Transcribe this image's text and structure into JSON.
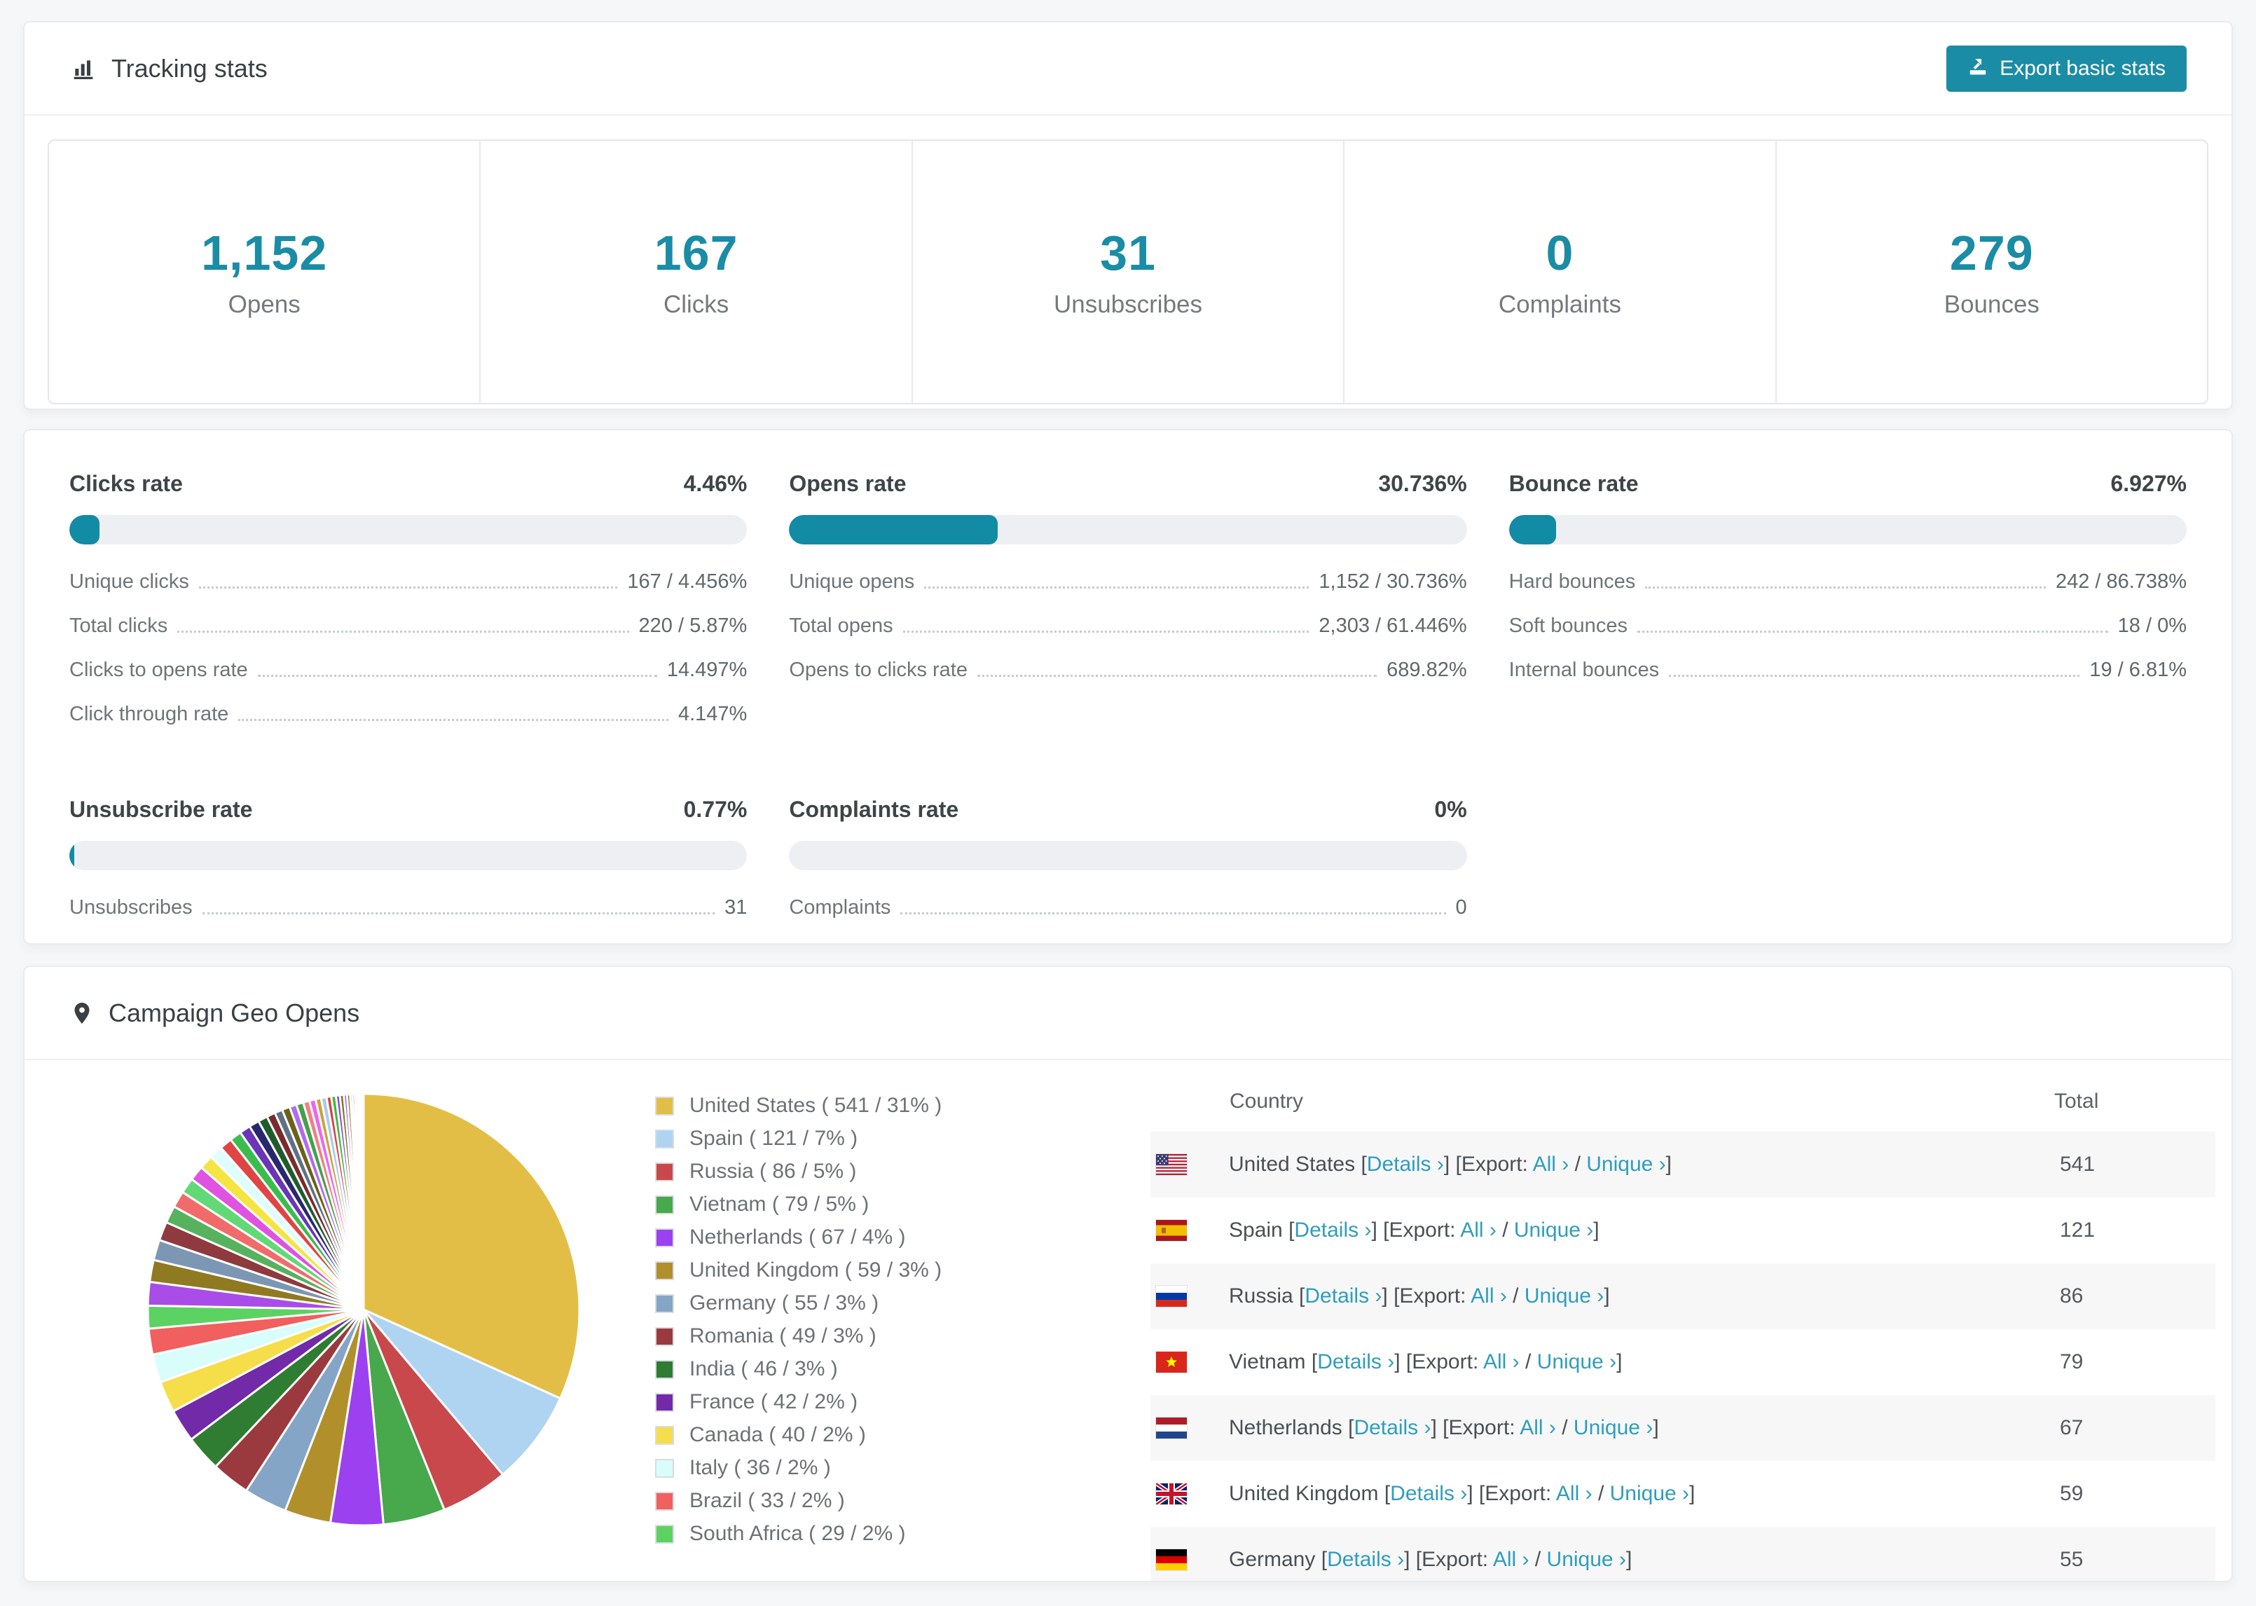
{
  "accent": {
    "teal": "#1b8ca6",
    "bar_fill": "#128ba5",
    "link": "#2f9dbd"
  },
  "tracking": {
    "title": "Tracking stats",
    "export_button": "Export basic stats",
    "summary": [
      {
        "value": "1,152",
        "label": "Opens"
      },
      {
        "value": "167",
        "label": "Clicks"
      },
      {
        "value": "31",
        "label": "Unsubscribes"
      },
      {
        "value": "0",
        "label": "Complaints"
      },
      {
        "value": "279",
        "label": "Bounces"
      }
    ]
  },
  "rate_panels": [
    {
      "title": "Clicks rate",
      "value": "4.46%",
      "pct": 4.46,
      "rows": [
        {
          "label": "Unique clicks",
          "value": "167 / 4.456%"
        },
        {
          "label": "Total clicks",
          "value": "220 / 5.87%"
        },
        {
          "label": "Clicks to opens rate",
          "value": "14.497%"
        },
        {
          "label": "Click through rate",
          "value": "4.147%"
        }
      ]
    },
    {
      "title": "Opens rate",
      "value": "30.736%",
      "pct": 30.736,
      "rows": [
        {
          "label": "Unique opens",
          "value": "1,152 / 30.736%"
        },
        {
          "label": "Total opens",
          "value": "2,303 / 61.446%"
        },
        {
          "label": "Opens to clicks rate",
          "value": "689.82%"
        }
      ]
    },
    {
      "title": "Bounce rate",
      "value": "6.927%",
      "pct": 6.927,
      "rows": [
        {
          "label": "Hard bounces",
          "value": "242 / 86.738%"
        },
        {
          "label": "Soft bounces",
          "value": "18 / 0%"
        },
        {
          "label": "Internal bounces",
          "value": "19 / 6.81%"
        }
      ]
    },
    {
      "title": "Unsubscribe rate",
      "value": "0.77%",
      "pct": 0.77,
      "rows": [
        {
          "label": "Unsubscribes",
          "value": "31"
        }
      ]
    },
    {
      "title": "Complaints rate",
      "value": "0%",
      "pct": 0,
      "rows": [
        {
          "label": "Complaints",
          "value": "0"
        }
      ]
    }
  ],
  "geo": {
    "title": "Campaign Geo Opens",
    "legend": [
      {
        "label": "United States ( 541 / 31% )",
        "color": "#E3BE47"
      },
      {
        "label": "Spain ( 121 / 7% )",
        "color": "#AFD4F2"
      },
      {
        "label": "Russia ( 86 / 5% )",
        "color": "#C8484C"
      },
      {
        "label": "Vietnam ( 79 / 5% )",
        "color": "#47A84C"
      },
      {
        "label": "Netherlands ( 67 / 4% )",
        "color": "#9B41F0"
      },
      {
        "label": "United Kingdom ( 59 / 3% )",
        "color": "#B1902C"
      },
      {
        "label": "Germany ( 55 / 3% )",
        "color": "#84A5C5"
      },
      {
        "label": "Romania ( 49 / 3% )",
        "color": "#9A3A3E"
      },
      {
        "label": "India ( 46 / 3% )",
        "color": "#2E7D32"
      },
      {
        "label": "France ( 42 / 2% )",
        "color": "#722AA8"
      },
      {
        "label": "Canada ( 40 / 2% )",
        "color": "#F6DE4B"
      },
      {
        "label": "Italy ( 36 / 2% )",
        "color": "#D9FDFA"
      },
      {
        "label": "Brazil ( 33 / 2% )",
        "color": "#F15F5F"
      },
      {
        "label": "South Africa ( 29 / 2% )",
        "color": "#5CD262"
      }
    ],
    "links": {
      "open": "[",
      "details": "Details ›",
      "close_open_export": "] [Export:",
      "all": "All ›",
      "slash": "/",
      "unique": "Unique ›",
      "close": "]"
    },
    "table": {
      "columns": [
        "Country",
        "Total"
      ],
      "rows": [
        {
          "country": "United States",
          "total": "541",
          "flag": "us"
        },
        {
          "country": "Spain",
          "total": "121",
          "flag": "es"
        },
        {
          "country": "Russia",
          "total": "86",
          "flag": "ru"
        },
        {
          "country": "Vietnam",
          "total": "79",
          "flag": "vn"
        },
        {
          "country": "Netherlands",
          "total": "67",
          "flag": "nl"
        },
        {
          "country": "United Kingdom",
          "total": "59",
          "flag": "gb"
        },
        {
          "country": "Germany",
          "total": "55",
          "flag": "de"
        }
      ]
    }
  },
  "chart_data": {
    "type": "pie",
    "title": "Campaign Geo Opens",
    "legend_position": "right",
    "series": [
      {
        "name": "United States",
        "value": 541,
        "pct": "31%",
        "color": "#E3BE47"
      },
      {
        "name": "Spain",
        "value": 121,
        "pct": "7%",
        "color": "#AFD4F2"
      },
      {
        "name": "Russia",
        "value": 86,
        "pct": "5%",
        "color": "#C8484C"
      },
      {
        "name": "Vietnam",
        "value": 79,
        "pct": "5%",
        "color": "#47A84C"
      },
      {
        "name": "Netherlands",
        "value": 67,
        "pct": "4%",
        "color": "#9B41F0"
      },
      {
        "name": "United Kingdom",
        "value": 59,
        "pct": "3%",
        "color": "#B1902C"
      },
      {
        "name": "Germany",
        "value": 55,
        "pct": "3%",
        "color": "#84A5C5"
      },
      {
        "name": "Romania",
        "value": 49,
        "pct": "3%",
        "color": "#9A3A3E"
      },
      {
        "name": "India",
        "value": 46,
        "pct": "3%",
        "color": "#2E7D32"
      },
      {
        "name": "France",
        "value": 42,
        "pct": "2%",
        "color": "#722AA8"
      },
      {
        "name": "Canada",
        "value": 40,
        "pct": "2%",
        "color": "#F6DE4B"
      },
      {
        "name": "Italy",
        "value": 36,
        "pct": "2%",
        "color": "#D9FDFA"
      },
      {
        "name": "Brazil",
        "value": 33,
        "pct": "2%",
        "color": "#F15F5F"
      },
      {
        "name": "South Africa",
        "value": 29,
        "pct": "2%",
        "color": "#5CD262"
      }
    ],
    "others": {
      "note": "long tail of small unlabeled countries",
      "values": [
        30,
        28,
        26,
        24,
        22,
        21,
        20,
        19,
        18,
        17,
        16,
        15,
        14,
        13,
        12,
        11,
        10,
        10,
        9,
        9,
        8,
        8,
        7,
        7,
        6,
        6,
        5,
        5,
        4,
        4,
        3,
        3,
        2,
        2,
        2,
        1,
        1,
        1,
        1,
        1
      ],
      "palette": [
        "#A94CE8",
        "#8F7A22",
        "#7C97B4",
        "#8E3A3E",
        "#57B25E",
        "#F26B6B",
        "#63D877",
        "#E052E0",
        "#F4E542",
        "#DFFDFC",
        "#E04545",
        "#3BBD4E",
        "#6A35B8",
        "#28286E",
        "#1F5C2B",
        "#7A2B2B",
        "#5E7286",
        "#6B6218",
        "#B06BF0",
        "#44A04E",
        "#F08080",
        "#EE66EE",
        "#C8A43C",
        "#A9CCEE",
        "#D94040",
        "#42B742",
        "#8A46C8",
        "#7D7420"
      ]
    }
  }
}
